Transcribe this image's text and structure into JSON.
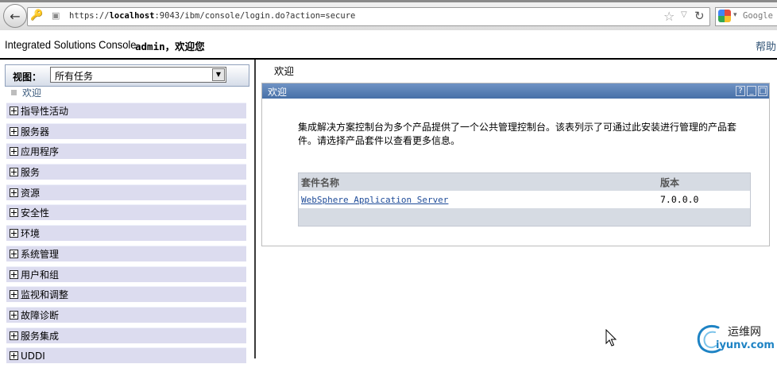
{
  "browser": {
    "url_prefix": "https://",
    "url_host": "localhost",
    "url_rest": ":9043/ibm/console/login.do?action=secure",
    "search_engine": "Google"
  },
  "header": {
    "title": "Integrated Solutions Console",
    "user": "admin",
    "greeting": "，欢迎您",
    "help": "帮助"
  },
  "nav": {
    "view_label": "视图：",
    "view_value": "所有任务",
    "welcome": "欢迎",
    "items": [
      "指导性活动",
      "服务器",
      "应用程序",
      "服务",
      "资源",
      "安全性",
      "环境",
      "系统管理",
      "用户和组",
      "监视和调整",
      "故障诊断",
      "服务集成",
      "UDDI"
    ]
  },
  "main": {
    "breadcrumb": "欢迎",
    "portlet_title": "欢迎",
    "help_glyph": "?",
    "intro": "集成解决方案控制台为多个产品提供了一个公共管理控制台。该表列示了可通过此安装进行管理的产品套件。请选择产品套件以查看更多信息。",
    "table": {
      "headers": [
        "套件名称",
        "版本"
      ],
      "rows": [
        {
          "name": "WebSphere Application Server",
          "version": "7.0.0.0"
        }
      ]
    }
  },
  "watermark": {
    "top": "运维网",
    "bottom": "iyunv.com"
  },
  "colors": {
    "portlet_bar": "#466fa7",
    "nav_item_bg": "#dcdcef",
    "link": "#1f4c99"
  }
}
